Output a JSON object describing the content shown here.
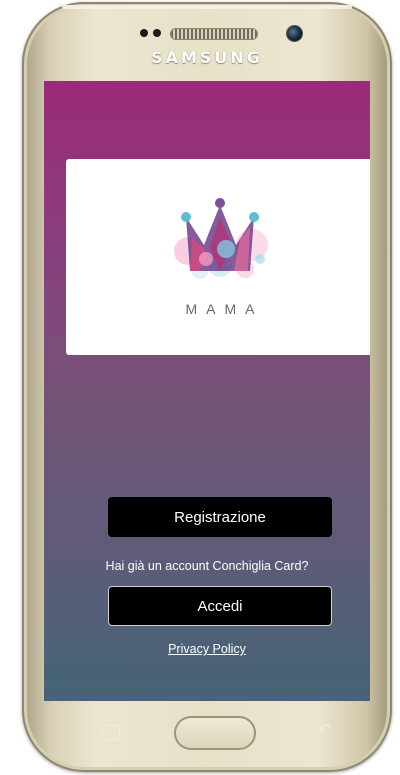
{
  "device": {
    "brand": "SAMSUNG"
  },
  "app": {
    "logo": {
      "text": "MAMA",
      "icon": "crown-icon"
    },
    "register_label": "Registrazione",
    "account_prompt": "Hai già un account Conchiglia Card?",
    "login_label": "Accedi",
    "privacy_label": "Privacy Policy"
  },
  "colors": {
    "background_top": "#9b2a78",
    "background_bottom": "#456576",
    "button": "#000000",
    "text": "#ffffff"
  }
}
